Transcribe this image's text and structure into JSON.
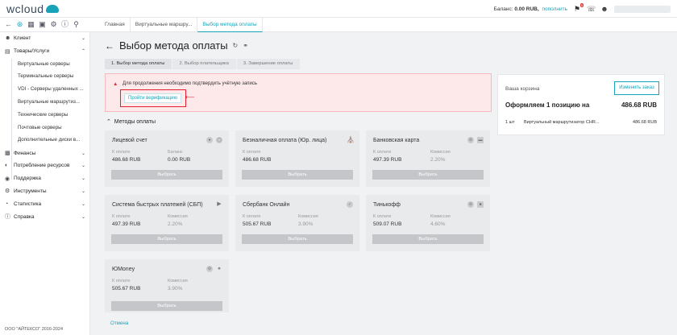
{
  "brand": {
    "logo_text": "wcloud"
  },
  "topbar": {
    "balance_label": "Баланс:",
    "balance_value": "0.00 RUB,",
    "topup_link": "пополнить",
    "notifications_count": "5"
  },
  "tabs": [
    {
      "label": "Главная"
    },
    {
      "label": "Виртуальные маршру..."
    },
    {
      "label": "Выбор метода оплаты"
    }
  ],
  "sidebar": {
    "items": [
      {
        "label": "Клиент",
        "icon": "user-icon"
      },
      {
        "label": "Товары/Услуги",
        "icon": "box-icon"
      },
      {
        "label": "Финансы",
        "icon": "wallet-icon"
      },
      {
        "label": "Потребление ресурсов",
        "icon": "gauge-icon"
      },
      {
        "label": "Поддержка",
        "icon": "support-icon"
      },
      {
        "label": "Инструменты",
        "icon": "gear-icon"
      },
      {
        "label": "Статистика",
        "icon": "stats-icon"
      },
      {
        "label": "Справка",
        "icon": "info-icon"
      }
    ],
    "subitems": [
      "Виртуальные серверы",
      "Терминальные серверы",
      "VDI - Серверы удаленных ...",
      "Виртуальные маршрутиз...",
      "Технические серверы",
      "Почтовые серверы",
      "Дополнительные диски в..."
    ],
    "footer": "ООО \"АЙТЕКСО\" 2016-2024"
  },
  "page": {
    "title": "Выбор метода оплаты",
    "steps": [
      "1. Выбор метода оплаты",
      "2. Выбор плательщика",
      "3. Завершение оплаты"
    ]
  },
  "alert": {
    "message": "Для продолжения необходимо подтвердить учётную запись",
    "verify_button": "Пройти верификацию"
  },
  "methods": {
    "section_title": "Методы оплаты",
    "cancel_link": "Отмена",
    "cards": [
      {
        "name": "Лицевой счет",
        "l1": "К оплате",
        "v1": "486.68 RUB",
        "l2": "Баланс",
        "v2": "0.00 RUB",
        "button": "Выбрать"
      },
      {
        "name": "Безналичная оплата (Юр. лица)",
        "l1": "К оплате",
        "v1": "486.68 RUB",
        "l2": "",
        "v2": "",
        "button": "Выбрать"
      },
      {
        "name": "Банковская карта",
        "l1": "К оплате",
        "v1": "497.39 RUB",
        "l2": "Комиссия",
        "v2": "2.20%",
        "button": "Выбрать"
      },
      {
        "name": "Система быстрых платежей (СБП)",
        "l1": "К оплате",
        "v1": "497.39 RUB",
        "l2": "Комиссия",
        "v2": "2.20%",
        "button": "Выбрать"
      },
      {
        "name": "Сбербанк Онлайн",
        "l1": "К оплате",
        "v1": "505.67 RUB",
        "l2": "Комиссия",
        "v2": "3.90%",
        "button": "Выбрать"
      },
      {
        "name": "Тинькофф",
        "l1": "К оплате",
        "v1": "509.07 RUB",
        "l2": "Комиссия",
        "v2": "4.60%",
        "button": "Выбрать"
      },
      {
        "name": "ЮMoney",
        "l1": "К оплате",
        "v1": "505.67 RUB",
        "l2": "Комиссия",
        "v2": "3.90%",
        "button": "Выбрать"
      }
    ]
  },
  "cart": {
    "title": "Ваша корзина",
    "change_button": "Изменить заказ",
    "summary": "Оформляем 1 позицию на",
    "total": "486.68 RUB",
    "row_qty": "1 шт",
    "row_name": "Виртуальный маршрутизатор CHR...",
    "row_price": "486.68 RUB"
  }
}
